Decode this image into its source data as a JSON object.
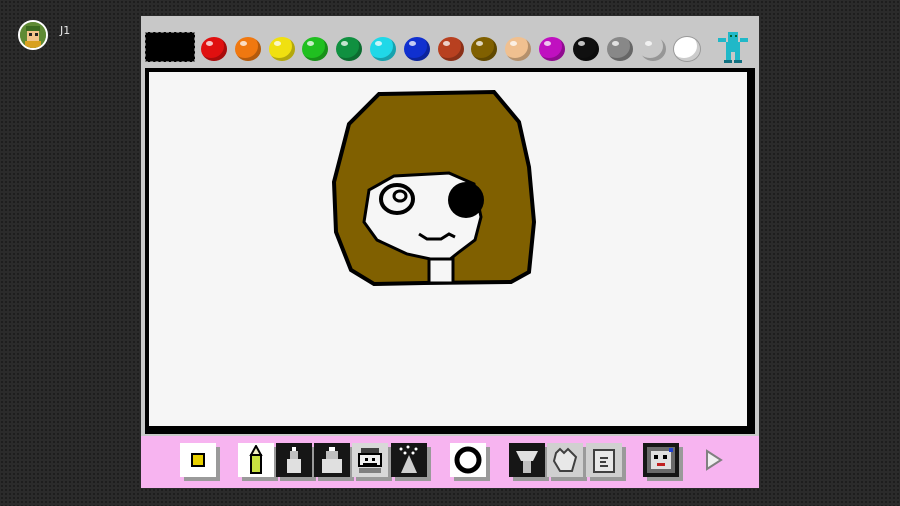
{
  "player": {
    "label": "J1",
    "avatar_icon": "player-avatar-icon"
  },
  "palette": {
    "current_color": "#000000",
    "colors": [
      {
        "name": "red",
        "hex": "#e01010"
      },
      {
        "name": "orange",
        "hex": "#f07810"
      },
      {
        "name": "yellow",
        "hex": "#f0e010"
      },
      {
        "name": "green",
        "hex": "#20c020"
      },
      {
        "name": "dark-green",
        "hex": "#109040"
      },
      {
        "name": "cyan",
        "hex": "#20d8e8"
      },
      {
        "name": "blue",
        "hex": "#1030d0"
      },
      {
        "name": "brown-red",
        "hex": "#b84020"
      },
      {
        "name": "brown",
        "hex": "#806000"
      },
      {
        "name": "peach",
        "hex": "#f0c090"
      },
      {
        "name": "magenta",
        "hex": "#c010c0"
      },
      {
        "name": "black",
        "hex": "#101010"
      },
      {
        "name": "gray",
        "hex": "#888888"
      },
      {
        "name": "light-gray",
        "hex": "#c8c8c8"
      },
      {
        "name": "white",
        "hex": "#ffffff"
      }
    ],
    "mascot_icon": "robot-mascot-icon"
  },
  "canvas": {
    "background": "#f6f6f6",
    "hair_color": "#806000"
  },
  "toolbar": {
    "background": "#f7b4f0",
    "tools": [
      {
        "name": "brush-size-tool",
        "icon": "brush-size-icon"
      },
      {
        "name": "pencil-tool",
        "icon": "pencil-icon"
      },
      {
        "name": "marker-tool",
        "icon": "marker-icon"
      },
      {
        "name": "thick-marker-tool",
        "icon": "thick-marker-icon"
      },
      {
        "name": "stamp-tool",
        "icon": "mario-stamp-icon"
      },
      {
        "name": "spray-tool",
        "icon": "spray-icon"
      },
      {
        "name": "shape-tool",
        "icon": "circle-icon"
      },
      {
        "name": "fill-tool",
        "icon": "paint-bucket-icon"
      },
      {
        "name": "hand-tool",
        "icon": "hand-icon"
      },
      {
        "name": "eraser-tool",
        "icon": "eraser-icon"
      },
      {
        "name": "undo-tool",
        "icon": "undo-dog-icon"
      },
      {
        "name": "next-page-tool",
        "icon": "arrow-right-icon"
      }
    ]
  }
}
